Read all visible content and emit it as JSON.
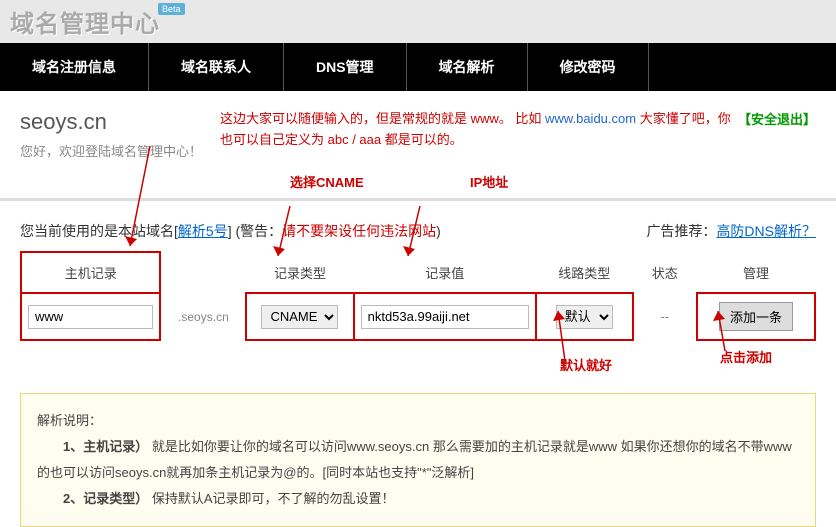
{
  "logo": {
    "text": "域名管理中心",
    "badge": "Beta"
  },
  "nav": [
    "域名注册信息",
    "域名联系人",
    "DNS管理",
    "域名解析",
    "修改密码"
  ],
  "header": {
    "domain": "seoys.cn",
    "welcome": "您好，欢迎登陆域名管理中心！",
    "logout": "【安全退出】"
  },
  "annotation_top": {
    "line1_a": "这边大家可以随便输入的，但是常规的就是 www。 比如 ",
    "line1_b": "www.baidu.com",
    "line1_c": " 大家懂了吧，你也可以自己定义为 abc / aaa  都是可以的。"
  },
  "annot_labels": {
    "cname": "选择CNAME",
    "ip": "IP地址",
    "default": "默认就好",
    "add": "点击添加"
  },
  "notice": {
    "prefix": "您当前使用的是本站域名[",
    "link1": "解析5号",
    "mid": "]   (警告：",
    "warn": "请不要架设任何违法网站",
    "suffix": ")",
    "ad_label": "广告推荐：",
    "ad_link": "高防DNS解析？"
  },
  "table": {
    "headers": {
      "host": "主机记录",
      "type": "记录类型",
      "value": "记录值",
      "line": "线路类型",
      "status": "状态",
      "manage": "管理"
    },
    "row": {
      "host_value": "www",
      "host_suffix": ".seoys.cn",
      "type_selected": "CNAME",
      "value": "nktd53a.99aiji.net",
      "line_selected": "默认",
      "status": "--",
      "add_btn": "添加一条"
    }
  },
  "explain": {
    "title": "解析说明：",
    "p1_label": "1、主机记录）",
    "p1_text": " 就是比如你要让你的域名可以访问www.seoys.cn 那么需要加的主机记录就是www 如果你还想你的域名不带www的也可以访问seoys.cn就再加条主机记录为@的。[同时本站也支持\"*\"泛解析]",
    "p2_label": "2、记录类型）",
    "p2_text": " 保持默认A记录即可，不了解的勿乱设置！"
  }
}
